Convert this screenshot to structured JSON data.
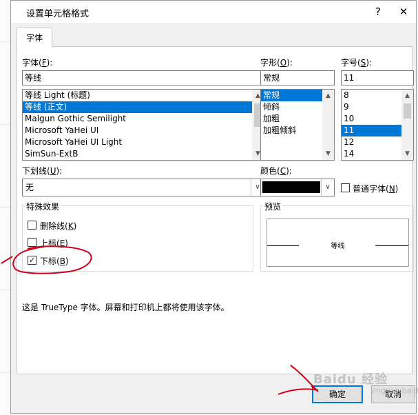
{
  "dialog": {
    "title": "设置单元格格式",
    "help": "?",
    "close": "✕",
    "tab": "字体"
  },
  "font": {
    "label": "字体(",
    "accel": "F",
    "label_end": "):",
    "value": "等线",
    "items": [
      {
        "label": "等线 Light (标题)",
        "selected": false
      },
      {
        "label": "等线 (正文)",
        "selected": true
      },
      {
        "label": "Malgun Gothic Semilight",
        "selected": false
      },
      {
        "label": "Microsoft YaHei UI",
        "selected": false
      },
      {
        "label": "Microsoft YaHei UI Light",
        "selected": false
      },
      {
        "label": "SimSun-ExtB",
        "selected": false
      }
    ]
  },
  "style": {
    "label": "字形(",
    "accel": "O",
    "label_end": "):",
    "value": "常规",
    "items": [
      {
        "label": "常规",
        "selected": true
      },
      {
        "label": "倾斜",
        "selected": false
      },
      {
        "label": "加粗",
        "selected": false
      },
      {
        "label": "加粗倾斜",
        "selected": false
      }
    ]
  },
  "size": {
    "label": "字号(",
    "accel": "S",
    "label_end": "):",
    "value": "11",
    "items": [
      {
        "label": "8",
        "selected": false
      },
      {
        "label": "9",
        "selected": false
      },
      {
        "label": "10",
        "selected": false
      },
      {
        "label": "11",
        "selected": true
      },
      {
        "label": "12",
        "selected": false
      },
      {
        "label": "14",
        "selected": false
      }
    ]
  },
  "underline": {
    "label": "下划线(",
    "accel": "U",
    "label_end": "):",
    "value": "无"
  },
  "color": {
    "label": "颜色(",
    "accel": "C",
    "label_end": "):",
    "swatch": "#000000",
    "normal_font_label": "普通字体(",
    "normal_font_accel": "N",
    "normal_font_end": ")",
    "normal_font_checked": false
  },
  "effects": {
    "title": "特殊效果",
    "strikethrough": {
      "label": "删除线(",
      "accel": "K",
      "end": ")",
      "checked": false
    },
    "superscript": {
      "label": "上标(",
      "accel": "E",
      "end": ")",
      "checked": false
    },
    "subscript": {
      "label": "下标(",
      "accel": "B",
      "end": ")",
      "checked": true
    }
  },
  "preview": {
    "title": "预览",
    "sample": "等线"
  },
  "info_text": "这是 TrueType 字体。屏幕和打印机上都将使用该字体。",
  "buttons": {
    "ok": "确定",
    "cancel": "取消"
  },
  "watermark": {
    "text": "Baidu 经验",
    "sub": "jingyan.baidu.com"
  },
  "colors": {
    "selection": "#0078d7",
    "annotation": "#d0021b"
  }
}
